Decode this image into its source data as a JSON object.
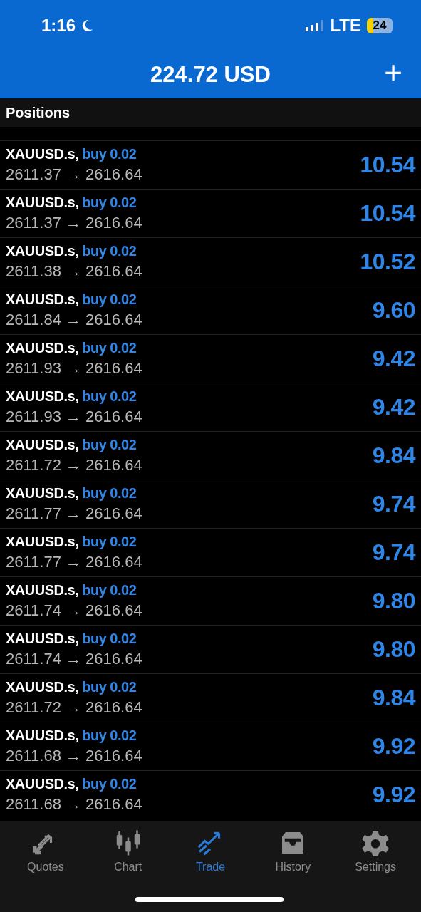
{
  "status_bar": {
    "time": "1:16",
    "carrier": "LTE",
    "battery": "24"
  },
  "header": {
    "title": "224.72 USD",
    "add": "+"
  },
  "section": {
    "title": "Positions"
  },
  "positions": [
    {
      "symbol": "XAUUSD.s,",
      "side": "buy 0.02",
      "prices": "2611.37 → 2616.64",
      "profit": "10.54"
    },
    {
      "symbol": "XAUUSD.s,",
      "side": "buy 0.02",
      "prices": "2611.37 → 2616.64",
      "profit": "10.54"
    },
    {
      "symbol": "XAUUSD.s,",
      "side": "buy 0.02",
      "prices": "2611.38 → 2616.64",
      "profit": "10.52"
    },
    {
      "symbol": "XAUUSD.s,",
      "side": "buy 0.02",
      "prices": "2611.84 → 2616.64",
      "profit": "9.60"
    },
    {
      "symbol": "XAUUSD.s,",
      "side": "buy 0.02",
      "prices": "2611.93 → 2616.64",
      "profit": "9.42"
    },
    {
      "symbol": "XAUUSD.s,",
      "side": "buy 0.02",
      "prices": "2611.93 → 2616.64",
      "profit": "9.42"
    },
    {
      "symbol": "XAUUSD.s,",
      "side": "buy 0.02",
      "prices": "2611.72 → 2616.64",
      "profit": "9.84"
    },
    {
      "symbol": "XAUUSD.s,",
      "side": "buy 0.02",
      "prices": "2611.77 → 2616.64",
      "profit": "9.74"
    },
    {
      "symbol": "XAUUSD.s,",
      "side": "buy 0.02",
      "prices": "2611.77 → 2616.64",
      "profit": "9.74"
    },
    {
      "symbol": "XAUUSD.s,",
      "side": "buy 0.02",
      "prices": "2611.74 → 2616.64",
      "profit": "9.80"
    },
    {
      "symbol": "XAUUSD.s,",
      "side": "buy 0.02",
      "prices": "2611.74 → 2616.64",
      "profit": "9.80"
    },
    {
      "symbol": "XAUUSD.s,",
      "side": "buy 0.02",
      "prices": "2611.72 → 2616.64",
      "profit": "9.84"
    },
    {
      "symbol": "XAUUSD.s,",
      "side": "buy 0.02",
      "prices": "2611.68 → 2616.64",
      "profit": "9.92"
    },
    {
      "symbol": "XAUUSD.s,",
      "side": "buy 0.02",
      "prices": "2611.68 → 2616.64",
      "profit": "9.92"
    }
  ],
  "tabs": [
    {
      "kind": "quotes",
      "label": "Quotes",
      "selected": false
    },
    {
      "kind": "chart",
      "label": "Chart",
      "selected": false
    },
    {
      "kind": "trade",
      "label": "Trade",
      "selected": true
    },
    {
      "kind": "history",
      "label": "History",
      "selected": false
    },
    {
      "kind": "settings",
      "label": "Settings",
      "selected": false
    }
  ]
}
